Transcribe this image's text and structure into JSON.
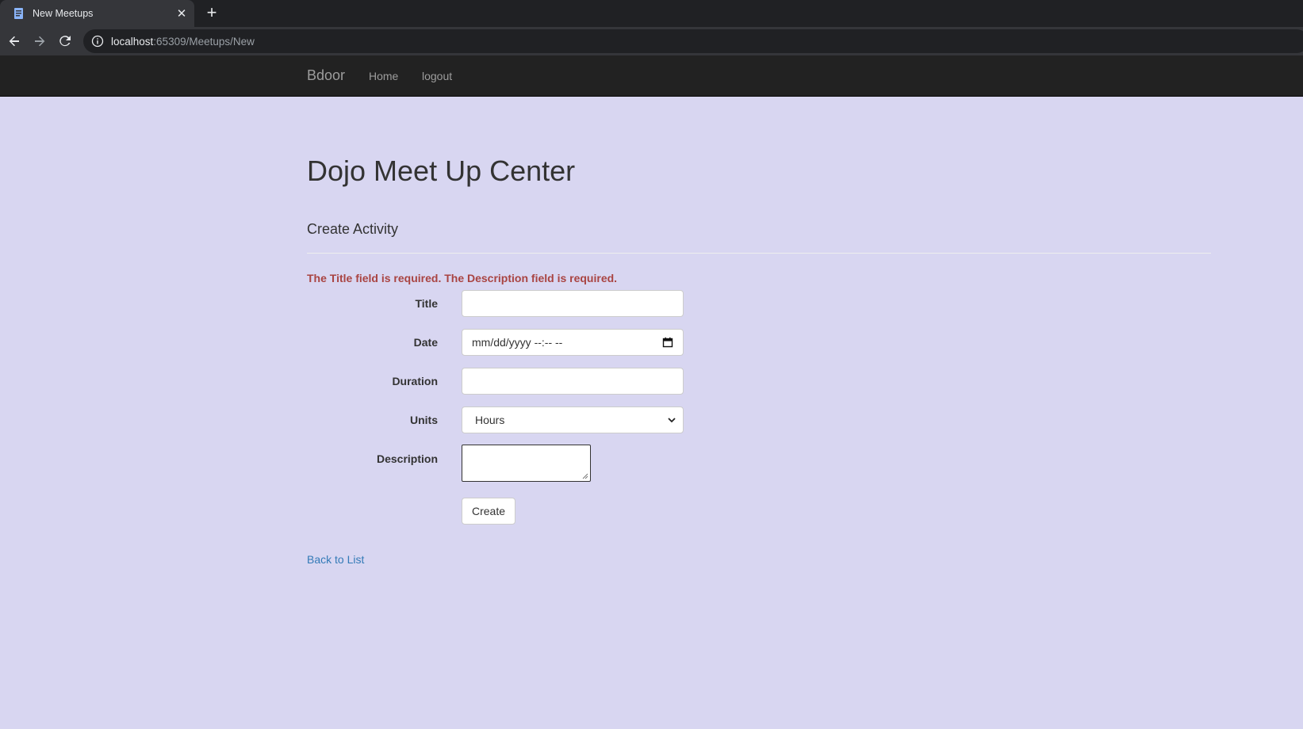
{
  "browser": {
    "tab_title": "New Meetups",
    "tab_close": "✕",
    "new_tab": "+",
    "url_host": "localhost",
    "url_rest": ":65309/Meetups/New"
  },
  "navbar": {
    "brand": "Bdoor",
    "links": [
      "Home",
      "logout"
    ]
  },
  "main": {
    "title": "Dojo Meet Up Center",
    "subtitle": "Create Activity",
    "validation_summary": "The Title field is required. The Description field is required.",
    "form": {
      "title_label": "Title",
      "title_value": "",
      "date_label": "Date",
      "date_placeholder": "mm/dd/yyyy --:-- --",
      "duration_label": "Duration",
      "duration_value": "",
      "units_label": "Units",
      "units_selected": "Hours",
      "description_label": "Description",
      "submit_label": "Create"
    },
    "back_link": "Back to List"
  }
}
